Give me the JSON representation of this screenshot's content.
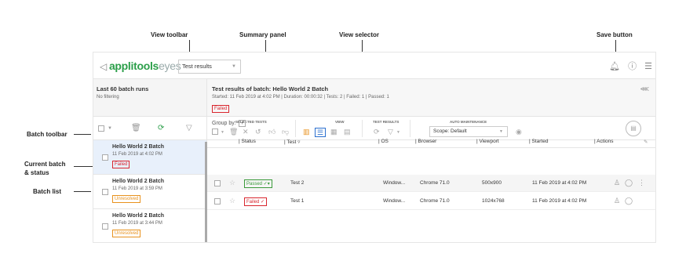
{
  "callouts": {
    "view_toolbar": "View toolbar",
    "summary_panel": "Summary panel",
    "view_selector": "View selector",
    "save_button": "Save button",
    "batch_toolbar": "Batch toolbar",
    "current_batch_line1": "Current batch",
    "current_batch_line2": "& status",
    "batch_list": "Batch list"
  },
  "header": {
    "logo_chevron": "◁",
    "logo_app": "applitools",
    "logo_product": "eyes",
    "mode_select": "Test results",
    "icons": [
      "bell-icon",
      "help-icon",
      "user-settings-icon"
    ]
  },
  "batches": {
    "title": "Last 60 batch runs",
    "filter": "No filtering",
    "items": [
      {
        "name": "Hello World 2 Batch",
        "date": "11 Feb 2019 at 4:02 PM",
        "status": "Failed"
      },
      {
        "name": "Hello World 2 Batch",
        "date": "11 Feb 2019 at 3:59 PM",
        "status": "Unresolved"
      },
      {
        "name": "Hello World 2 Batch",
        "date": "11 Feb 2019 at 3:44 PM",
        "status": "Unresolved"
      }
    ]
  },
  "summary": {
    "title": "Test results of batch: Hello World 2 Batch",
    "stats": "Started: 11 Feb 2019 at 4:02 PM  |  Duration: 00:00:32  |  Tests: 2  |  Failed: 1  |  Passed: 1",
    "status": "Failed"
  },
  "toolbar": {
    "selected_tests": "SELECTED TESTS",
    "view": "VIEW",
    "test_results": "TEST RESULTS",
    "auto_maintenance": "AUTO MAINTENANCE",
    "scope": "Scope: Default"
  },
  "table": {
    "group_by": "Group by:",
    "columns": [
      "Status",
      "Test",
      "OS",
      "Browser",
      "Viewport",
      "Started",
      "Actions"
    ],
    "rows": [
      {
        "status": "Passed",
        "test": "Test 2",
        "os": "Window...",
        "browser": "Chrome 71.0",
        "viewport": "500x900",
        "started": "11 Feb 2019 at 4:02 PM"
      },
      {
        "status": "Failed",
        "test": "Test 1",
        "os": "Window...",
        "browser": "Chrome 71.0",
        "viewport": "1024x768",
        "started": "11 Feb 2019 at 4:02 PM"
      }
    ]
  },
  "colors": {
    "brand": "#2c9f4a",
    "failed": "#d9262e",
    "unresolved": "#e8921e",
    "passed": "#3a9a3a",
    "selection": "#e8f0fb"
  }
}
